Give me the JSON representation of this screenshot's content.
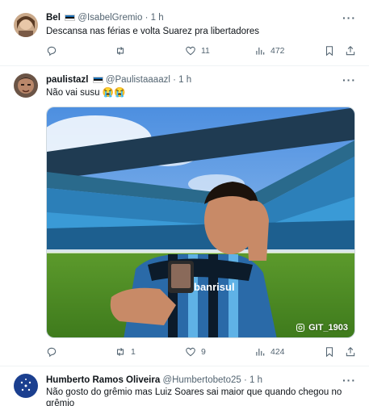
{
  "tweets": [
    {
      "name": "Bel",
      "handle": "@IsabelGremio",
      "time": "1 h",
      "text": "Descansa nas férias e volta Suarez pra libertadores",
      "replies": "",
      "retweets": "",
      "likes": "11",
      "views": "472"
    },
    {
      "name": "paulistazl",
      "handle": "@Paulistaaaazl",
      "time": "1 h",
      "text": "Não vai susu 😭😭",
      "replies": "",
      "retweets": "1",
      "likes": "9",
      "views": "424",
      "media_watermark": "GIT_1903",
      "jersey_text": "banrisul"
    },
    {
      "name": "Humberto Ramos Oliveira",
      "handle": "@Humbertobeto25",
      "time": "1 h",
      "text": "Não gosto do grêmio mas Luiz Soares sai maior que quando chegou no grêmio"
    }
  ],
  "separator": "·",
  "more": "···",
  "icons": [
    "reply-icon",
    "retweet-icon",
    "like-icon",
    "views-icon",
    "bookmark-icon",
    "share-icon",
    "more-icon",
    "flag-icon"
  ],
  "colors": {
    "text": "#0f1419",
    "muted": "#536471",
    "divider": "#eff3f4",
    "gremio_blue": "#1a6fb5"
  }
}
